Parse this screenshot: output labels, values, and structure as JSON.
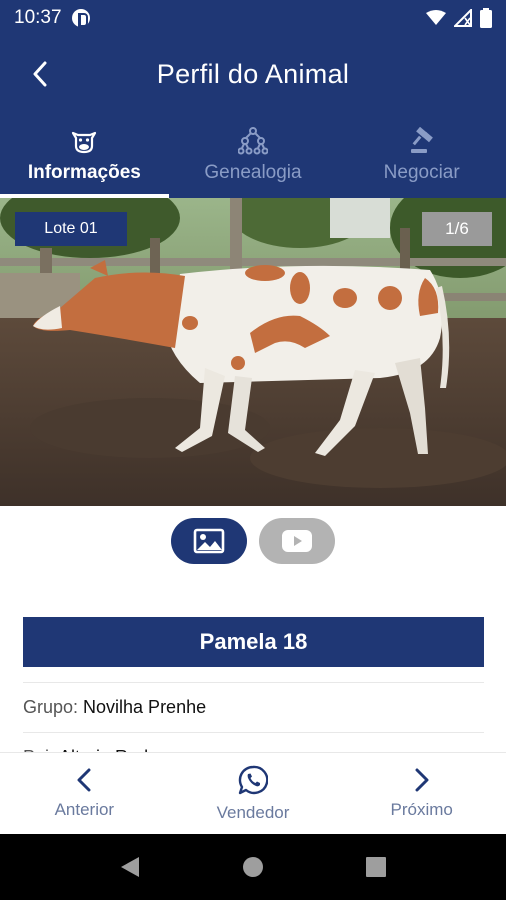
{
  "status_bar": {
    "time": "10:37"
  },
  "header": {
    "title": "Perfil do Animal"
  },
  "tabs": [
    {
      "label": "Informações",
      "icon": "cow-face-icon",
      "active": true
    },
    {
      "label": "Genealogia",
      "icon": "family-tree-icon",
      "active": false
    },
    {
      "label": "Negociar",
      "icon": "gavel-icon",
      "active": false
    }
  ],
  "photo": {
    "lote_label": "Lote 01",
    "counter": "1/6"
  },
  "animal": {
    "name": "Pamela 18"
  },
  "info": [
    {
      "label": "Grupo:",
      "value": "Novilha Prenhe"
    },
    {
      "label": "Pai:",
      "value": "Altoria Red"
    }
  ],
  "bottom_nav": {
    "prev_label": "Anterior",
    "seller_label": "Vendedor",
    "next_label": "Próximo"
  },
  "colors": {
    "primary": "#1f3775",
    "inactive_tab": "#8a9cc6",
    "gray_badge": "#9a9a9a"
  }
}
